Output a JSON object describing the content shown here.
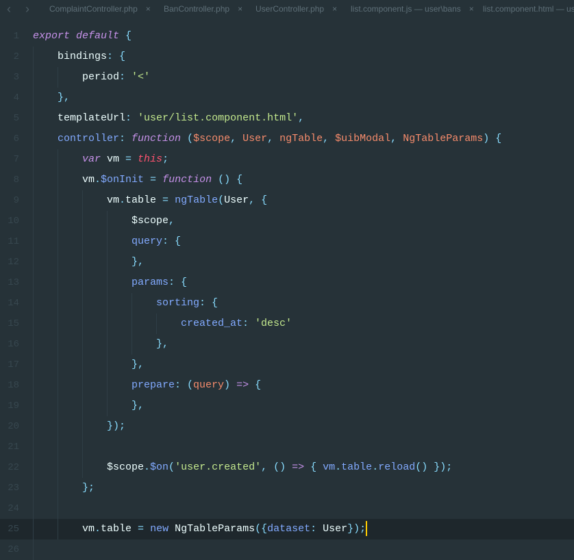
{
  "tabs": [
    {
      "label": "ComplaintController.php",
      "close": "×"
    },
    {
      "label": "BanController.php",
      "close": "×"
    },
    {
      "label": "UserController.php",
      "close": "×"
    },
    {
      "label": "list.component.js — user\\bans",
      "close": "×"
    },
    {
      "label": "list.component.html — user",
      "close": ""
    }
  ],
  "nav": {
    "back": "‹",
    "forward": "›"
  },
  "colors": {
    "background": "#263238",
    "keyword": "#c792ea",
    "string": "#c3e88d",
    "property": "#82aaff",
    "punctuation": "#89ddff",
    "parameter": "#f78c6c",
    "cursor": "#ffcc00"
  },
  "current_line": 25,
  "lines": [
    {
      "n": "1",
      "indent": 0,
      "t": [
        [
          "export default",
          "kw"
        ],
        [
          " {",
          "pu"
        ]
      ]
    },
    {
      "n": "2",
      "indent": 1,
      "t": [
        [
          "bindings",
          "pl"
        ],
        [
          ": {",
          "pu"
        ]
      ]
    },
    {
      "n": "3",
      "indent": 2,
      "t": [
        [
          "period",
          "pl"
        ],
        [
          ": ",
          "pu"
        ],
        [
          "'<'",
          "st"
        ]
      ]
    },
    {
      "n": "4",
      "indent": 1,
      "t": [
        [
          "},",
          "pu"
        ]
      ]
    },
    {
      "n": "5",
      "indent": 1,
      "t": [
        [
          "templateUrl",
          "pl"
        ],
        [
          ": ",
          "pu"
        ],
        [
          "'user/list.component.html'",
          "st"
        ],
        [
          ",",
          "pu"
        ]
      ]
    },
    {
      "n": "6",
      "indent": 1,
      "t": [
        [
          "controller",
          "pr"
        ],
        [
          ": ",
          "pu"
        ],
        [
          "function",
          "kw"
        ],
        [
          " (",
          "pu"
        ],
        [
          "$scope",
          "pa"
        ],
        [
          ", ",
          "pu"
        ],
        [
          "User",
          "pa"
        ],
        [
          ", ",
          "pu"
        ],
        [
          "ngTable",
          "pa"
        ],
        [
          ", ",
          "pu"
        ],
        [
          "$uibModal",
          "pa"
        ],
        [
          ", ",
          "pu"
        ],
        [
          "NgTableParams",
          "pa"
        ],
        [
          ") {",
          "pu"
        ]
      ]
    },
    {
      "n": "7",
      "indent": 2,
      "t": [
        [
          "var",
          "kw"
        ],
        [
          " vm ",
          "pl"
        ],
        [
          "= ",
          "pu"
        ],
        [
          "this",
          "th"
        ],
        [
          ";",
          "pu"
        ]
      ]
    },
    {
      "n": "8",
      "indent": 2,
      "t": [
        [
          "vm",
          "pl"
        ],
        [
          ".",
          "pu"
        ],
        [
          "$onInit",
          "pr"
        ],
        [
          " = ",
          "pu"
        ],
        [
          "function",
          "kw"
        ],
        [
          " () {",
          "pu"
        ]
      ]
    },
    {
      "n": "9",
      "indent": 3,
      "t": [
        [
          "vm",
          "pl"
        ],
        [
          ".",
          "pu"
        ],
        [
          "table",
          "pl"
        ],
        [
          " = ",
          "pu"
        ],
        [
          "ngTable",
          "pr"
        ],
        [
          "(",
          "pu"
        ],
        [
          "User",
          "pl"
        ],
        [
          ", {",
          "pu"
        ]
      ]
    },
    {
      "n": "10",
      "indent": 4,
      "t": [
        [
          "$scope",
          "pl"
        ],
        [
          ",",
          "pu"
        ]
      ]
    },
    {
      "n": "11",
      "indent": 4,
      "t": [
        [
          "query",
          "pr"
        ],
        [
          ": {",
          "pu"
        ]
      ]
    },
    {
      "n": "12",
      "indent": 4,
      "t": [
        [
          "},",
          "pu"
        ]
      ]
    },
    {
      "n": "13",
      "indent": 4,
      "t": [
        [
          "params",
          "pr"
        ],
        [
          ": {",
          "pu"
        ]
      ]
    },
    {
      "n": "14",
      "indent": 5,
      "t": [
        [
          "sorting",
          "pr"
        ],
        [
          ": {",
          "pu"
        ]
      ]
    },
    {
      "n": "15",
      "indent": 6,
      "t": [
        [
          "created_at",
          "pr"
        ],
        [
          ": ",
          "pu"
        ],
        [
          "'desc'",
          "st"
        ]
      ]
    },
    {
      "n": "16",
      "indent": 5,
      "t": [
        [
          "},",
          "pu"
        ]
      ]
    },
    {
      "n": "17",
      "indent": 4,
      "t": [
        [
          "},",
          "pu"
        ]
      ]
    },
    {
      "n": "18",
      "indent": 4,
      "t": [
        [
          "prepare",
          "pr"
        ],
        [
          ": (",
          "pu"
        ],
        [
          "query",
          "pa"
        ],
        [
          ") ",
          "pu"
        ],
        [
          "=>",
          "kw"
        ],
        [
          " {",
          "pu"
        ]
      ]
    },
    {
      "n": "19",
      "indent": 4,
      "t": [
        [
          "},",
          "pu"
        ]
      ]
    },
    {
      "n": "20",
      "indent": 3,
      "t": [
        [
          "});",
          "pu"
        ]
      ]
    },
    {
      "n": "21",
      "indent": 3,
      "t": []
    },
    {
      "n": "22",
      "indent": 3,
      "t": [
        [
          "$scope",
          "pl"
        ],
        [
          ".",
          "pu"
        ],
        [
          "$on",
          "pr"
        ],
        [
          "(",
          "pu"
        ],
        [
          "'user.created'",
          "st"
        ],
        [
          ", () ",
          "pu"
        ],
        [
          "=>",
          "kw"
        ],
        [
          " { ",
          "pu"
        ],
        [
          "vm",
          "pr"
        ],
        [
          ".",
          "pu"
        ],
        [
          "table",
          "pr"
        ],
        [
          ".",
          "pu"
        ],
        [
          "reload",
          "pr"
        ],
        [
          "() });",
          "pu"
        ]
      ]
    },
    {
      "n": "23",
      "indent": 2,
      "t": [
        [
          "};",
          "pu"
        ]
      ]
    },
    {
      "n": "24",
      "indent": 2,
      "t": []
    },
    {
      "n": "25",
      "indent": 2,
      "t": [
        [
          "vm",
          "pl"
        ],
        [
          ".",
          "pu"
        ],
        [
          "table",
          "pl"
        ],
        [
          " = ",
          "pu"
        ],
        [
          "new",
          "pr"
        ],
        [
          " NgTableParams",
          "pl"
        ],
        [
          "({",
          "pu"
        ],
        [
          "dataset",
          "pr"
        ],
        [
          ": ",
          "pu"
        ],
        [
          "User",
          "pl"
        ],
        [
          "});",
          "pu"
        ]
      ]
    },
    {
      "n": "26",
      "indent": 1,
      "t": []
    }
  ]
}
